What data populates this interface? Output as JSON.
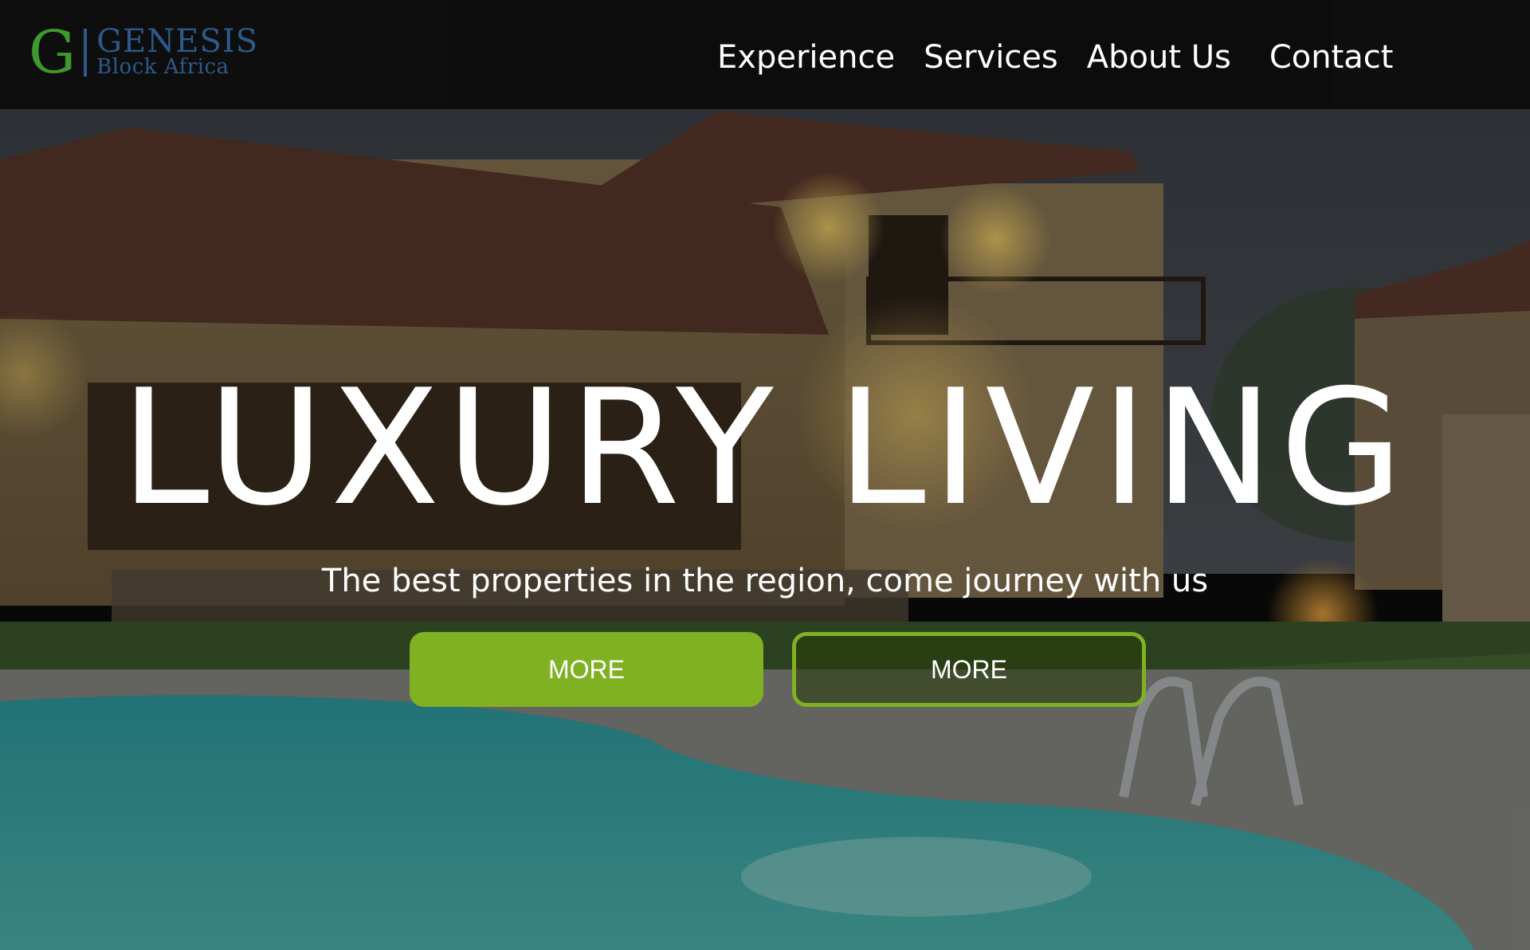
{
  "logo": {
    "letter": "G",
    "name": "GENESIS",
    "subtitle": "Block Africa"
  },
  "nav": {
    "items": [
      {
        "label": "Experience"
      },
      {
        "label": "Services"
      },
      {
        "label": "About Us"
      },
      {
        "label": "Contact"
      }
    ]
  },
  "hero": {
    "title": "LUXURY LIVING",
    "subtitle": "The best properties in the region, come journey with us",
    "primary_button": "MORE",
    "secondary_button": "MORE"
  },
  "colors": {
    "accent": "#7fb122",
    "logo_green": "#3f9a2e",
    "logo_blue": "#2c5a8a",
    "navbar": "#0c0c0c"
  },
  "icons": {
    "background": "house-with-pool-photo"
  }
}
